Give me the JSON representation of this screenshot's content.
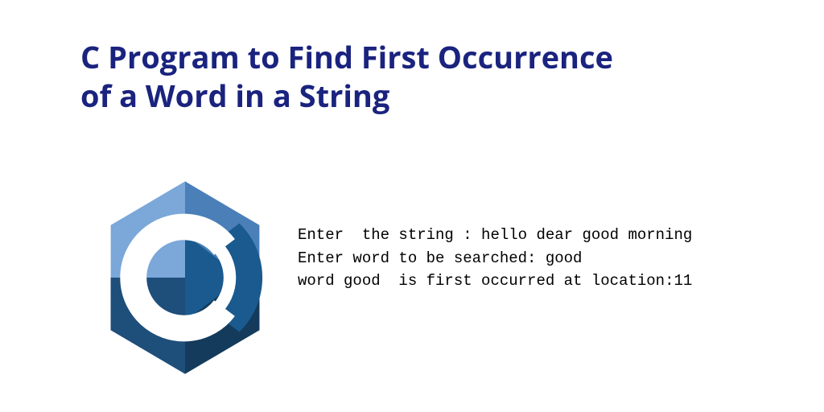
{
  "title_line1": "C Program to Find First Occurrence",
  "title_line2": "of a Word in a String",
  "output": {
    "line1": "Enter  the string : hello dear good morning",
    "line2": "Enter word to be searched: good",
    "line3": "word good  is first occurred at location:11"
  },
  "colors": {
    "title": "#1a237e",
    "logo_light": "#7ba7d9",
    "logo_mid": "#4a7fb8",
    "logo_dark": "#1e4e7a",
    "logo_accent": "#1a5a8e"
  }
}
